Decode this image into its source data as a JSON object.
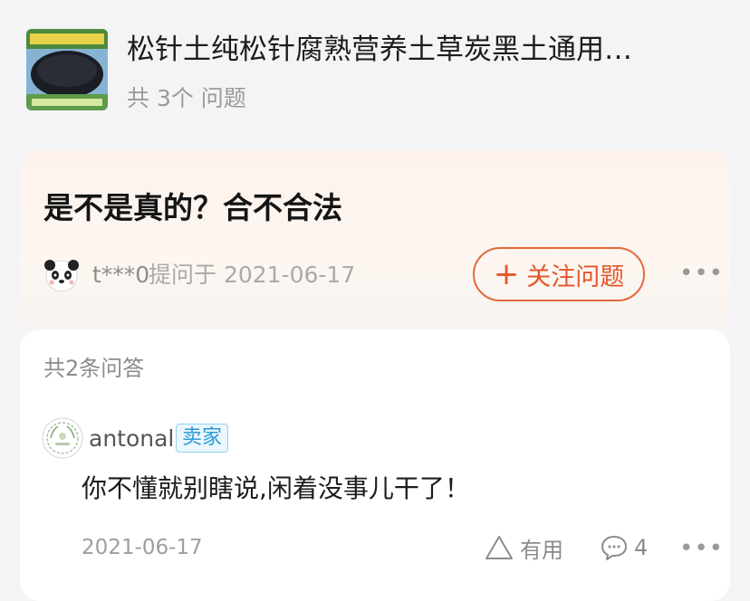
{
  "product": {
    "title": "松针土纯松针腐熟营养土草炭黑土通用…",
    "question_count": "共 3个 问题",
    "thumbnail_icon": "product-thumbnail"
  },
  "question": {
    "title": "是不是真的？合不合法",
    "asker": "t***0",
    "asked_on": "提问于 2021-06-17",
    "follow_label": "关注问题",
    "follow_icon": "plus-icon",
    "more_label": "•••",
    "accent": "#e3572a"
  },
  "answers": {
    "count_label": "共2条问答",
    "items": [
      {
        "user": "antonal",
        "badge": "卖家",
        "text": "你不懂就别瞎说,闲着没事儿干了！",
        "date": "2021-06-17",
        "useful_label": "有用",
        "comment_count": "4",
        "more_label": "•••"
      }
    ]
  }
}
